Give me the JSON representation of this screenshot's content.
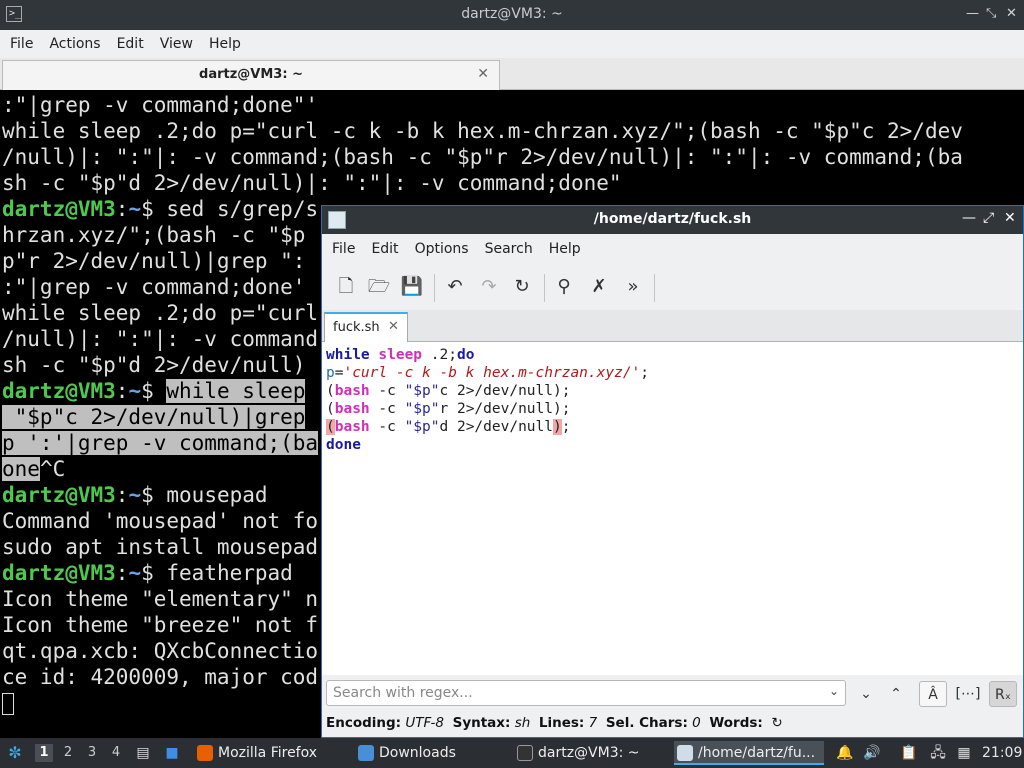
{
  "terminal": {
    "window_title": "dartz@VM3: ~",
    "tab_label": "dartz@VM3: ~",
    "menu": [
      "File",
      "Actions",
      "Edit",
      "View",
      "Help"
    ],
    "lines": [
      [
        {
          "t": ":\"|grep -v command;done\"'"
        }
      ],
      [
        {
          "t": "while sleep .2;do p=\"curl -c k -b k hex.m-chrzan.xyz/\";(bash -c \"$p\"c 2>/dev"
        }
      ],
      [
        {
          "t": "/null)|: \":\"|: -v command;(bash -c \"$p\"r 2>/dev/null)|: \":\"|: -v command;(ba"
        }
      ],
      [
        {
          "t": "sh -c \"$p\"d 2>/dev/null)|: \":\"|: -v command;done\""
        }
      ],
      [
        {
          "t": "dartz@VM3",
          "c": "pu"
        },
        {
          "t": ":",
          "c": ""
        },
        {
          "t": "~",
          "c": "pp"
        },
        {
          "t": "$ sed s/grep/s"
        }
      ],
      [
        {
          "t": "hrzan.xyz/\";(bash -c \"$p"
        }
      ],
      [
        {
          "t": "p\"r 2>/dev/null)|grep \":"
        }
      ],
      [
        {
          "t": ":\"|grep -v command;done'"
        }
      ],
      [
        {
          "t": "while sleep .2;do p=\"curl"
        }
      ],
      [
        {
          "t": "/null)|: \":\"|: -v command"
        }
      ],
      [
        {
          "t": "sh -c \"$p\"d 2>/dev/null)"
        }
      ],
      [
        {
          "t": "dartz@VM3",
          "c": "pu"
        },
        {
          "t": ":",
          "c": ""
        },
        {
          "t": "~",
          "c": "pp"
        },
        {
          "t": "$ "
        },
        {
          "t": "while sleep",
          "c": "sel"
        }
      ],
      [
        {
          "t": " \"$p\"c 2>/dev/null)|grep",
          "c": "sel"
        }
      ],
      [
        {
          "t": "p ':'|grep -v command;(ba",
          "c": "sel"
        }
      ],
      [
        {
          "t": "one",
          "c": "sel"
        },
        {
          "t": "^C"
        }
      ],
      [
        {
          "t": "dartz@VM3",
          "c": "pu"
        },
        {
          "t": ":",
          "c": ""
        },
        {
          "t": "~",
          "c": "pp"
        },
        {
          "t": "$ mousepad"
        }
      ],
      [
        {
          "t": "Command 'mousepad' not fo"
        }
      ],
      [
        {
          "t": "sudo apt install mousepad"
        }
      ],
      [
        {
          "t": "dartz@VM3",
          "c": "pu"
        },
        {
          "t": ":",
          "c": ""
        },
        {
          "t": "~",
          "c": "pp"
        },
        {
          "t": "$ featherpad"
        }
      ],
      [
        {
          "t": "Icon theme \"elementary\" n"
        }
      ],
      [
        {
          "t": "Icon theme \"breeze\" not f"
        }
      ],
      [
        {
          "t": "qt.qpa.xcb: QXcbConnectio"
        }
      ],
      [
        {
          "t": "ce id: 4200009, major cod"
        }
      ]
    ]
  },
  "featherpad": {
    "window_title": "/home/dartz/fuck.sh",
    "menu": [
      "File",
      "Edit",
      "Options",
      "Search",
      "Help"
    ],
    "tab_label": "fuck.sh",
    "code": [
      [
        {
          "t": "while",
          "c": "kw"
        },
        {
          "t": " "
        },
        {
          "t": "sleep",
          "c": "kwm"
        },
        {
          "t": " .2;"
        },
        {
          "t": "do",
          "c": "kw"
        }
      ],
      [
        {
          "t": "p",
          "c": "var"
        },
        {
          "t": "="
        },
        {
          "t": "'curl -c k -b k hex.m-chrzan.xyz/'",
          "c": "str"
        },
        {
          "t": ";"
        }
      ],
      [
        {
          "t": "("
        },
        {
          "t": "bash",
          "c": "kwm"
        },
        {
          "t": " -c "
        },
        {
          "t": "\"$p\"",
          "c": "strd"
        },
        {
          "t": "c 2>/dev/null);"
        }
      ],
      [
        {
          "t": "("
        },
        {
          "t": "bash",
          "c": "kwm"
        },
        {
          "t": " -c "
        },
        {
          "t": "\"$p\"",
          "c": "strd"
        },
        {
          "t": "r 2>/dev/null);"
        }
      ],
      [
        {
          "t": "(",
          "c": "bm"
        },
        {
          "t": "bash",
          "c": "kwm"
        },
        {
          "t": " -c "
        },
        {
          "t": "\"$p\"",
          "c": "strd"
        },
        {
          "t": "d 2>/dev/null"
        },
        {
          "t": ")",
          "c": "bm"
        },
        {
          "t": ";"
        }
      ],
      [
        {
          "t": "done",
          "c": "kw"
        }
      ]
    ],
    "search_placeholder": "Search with regex...",
    "status": {
      "encoding_label": "Encoding:",
      "encoding": "UTF-8",
      "syntax_label": "Syntax:",
      "syntax": "sh",
      "lines_label": "Lines:",
      "lines": "7",
      "selchars_label": "Sel. Chars:",
      "selchars": "0",
      "words_label": "Words:"
    }
  },
  "taskbar": {
    "workspaces": [
      "1",
      "2",
      "3",
      "4"
    ],
    "tasks": [
      {
        "label": "Mozilla Firefox",
        "icon": "firefox-icon"
      },
      {
        "label": "Downloads",
        "icon": "folder-icon"
      },
      {
        "label": "dartz@VM3: ~",
        "icon": "terminal-icon"
      },
      {
        "label": "/home/dartz/fu...",
        "icon": "featherpad-icon"
      }
    ],
    "clock": "21:09"
  }
}
